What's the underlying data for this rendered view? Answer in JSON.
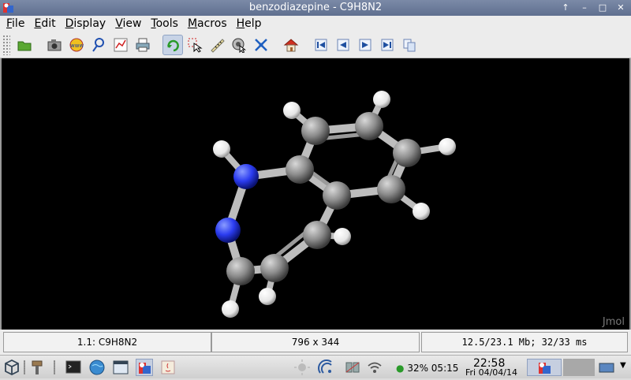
{
  "window": {
    "title": "benzodiazepine - C9H8N2"
  },
  "menu": {
    "items": [
      {
        "label": "File",
        "key": "F",
        "rest": "ile"
      },
      {
        "label": "Edit",
        "key": "E",
        "rest": "dit"
      },
      {
        "label": "Display",
        "key": "D",
        "rest": "isplay"
      },
      {
        "label": "View",
        "key": "V",
        "rest": "iew"
      },
      {
        "label": "Tools",
        "key": "T",
        "rest": "ools"
      },
      {
        "label": "Macros",
        "key": "M",
        "rest": "acros"
      },
      {
        "label": "Help",
        "key": "H",
        "rest": "elp"
      }
    ]
  },
  "toolbar": {
    "buttons": [
      "open-icon",
      "camera-icon",
      "www-icon",
      "magnify-icon",
      "graph-icon",
      "print-icon",
      "rotate-icon",
      "select-icon",
      "ruler-icon",
      "pick-icon",
      "move-icon",
      "home-icon",
      "first-frame-icon",
      "prev-frame-icon",
      "next-frame-icon",
      "last-frame-icon",
      "copy-frames-icon"
    ],
    "active": "rotate-icon"
  },
  "viewer": {
    "watermark": "Jmol",
    "colors": {
      "carbon": "#8c8c8c",
      "nitrogen": "#2b3cf0",
      "hydrogen": "#f2f2f2",
      "background": "#000000"
    }
  },
  "status": {
    "model": "1.1: C9H8N2",
    "size": "796 x 344",
    "memory": "12.5/23.1 Mb;  32/33 ms"
  },
  "taskbar": {
    "battery": "32% 05:15",
    "time": "22:58",
    "date": "Fri 04/04/14"
  }
}
